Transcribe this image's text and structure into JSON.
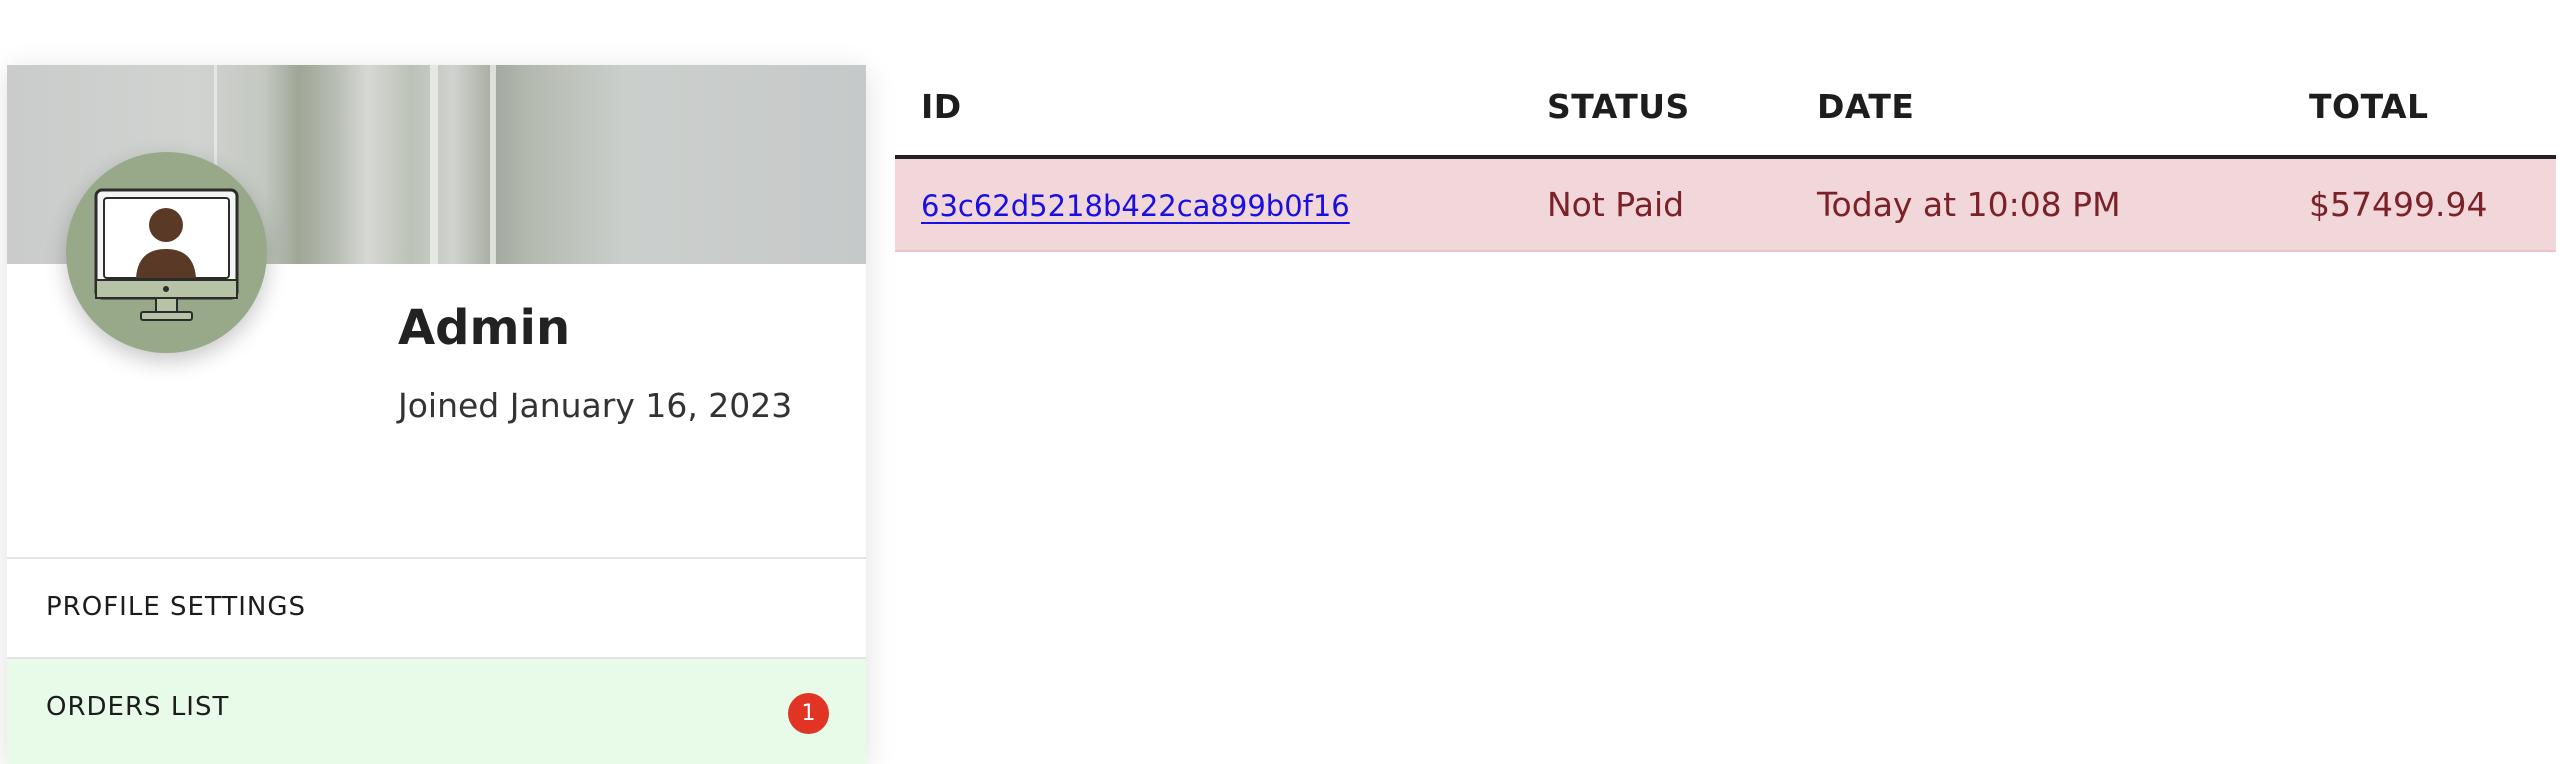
{
  "profile": {
    "name": "Admin",
    "joined": "Joined January 16, 2023",
    "avatar_icon": "user-monitor-icon",
    "menu": [
      {
        "label": "PROFILE SETTINGS",
        "active": false
      },
      {
        "label": "ORDERS LIST",
        "active": true,
        "badge": "1"
      }
    ]
  },
  "orders": {
    "columns": [
      "ID",
      "STATUS",
      "DATE",
      "TOTAL"
    ],
    "rows": [
      {
        "id": "63c62d5218b422ca899b0f16",
        "status": "Not Paid",
        "date": "Today at 10:08 PM",
        "total": "$57499.94"
      }
    ]
  },
  "colors": {
    "accent_active_menu": "#e8fbe8",
    "badge": "#e23424",
    "unpaid_row": "#f2d7da",
    "link": "#1a0fe3"
  }
}
